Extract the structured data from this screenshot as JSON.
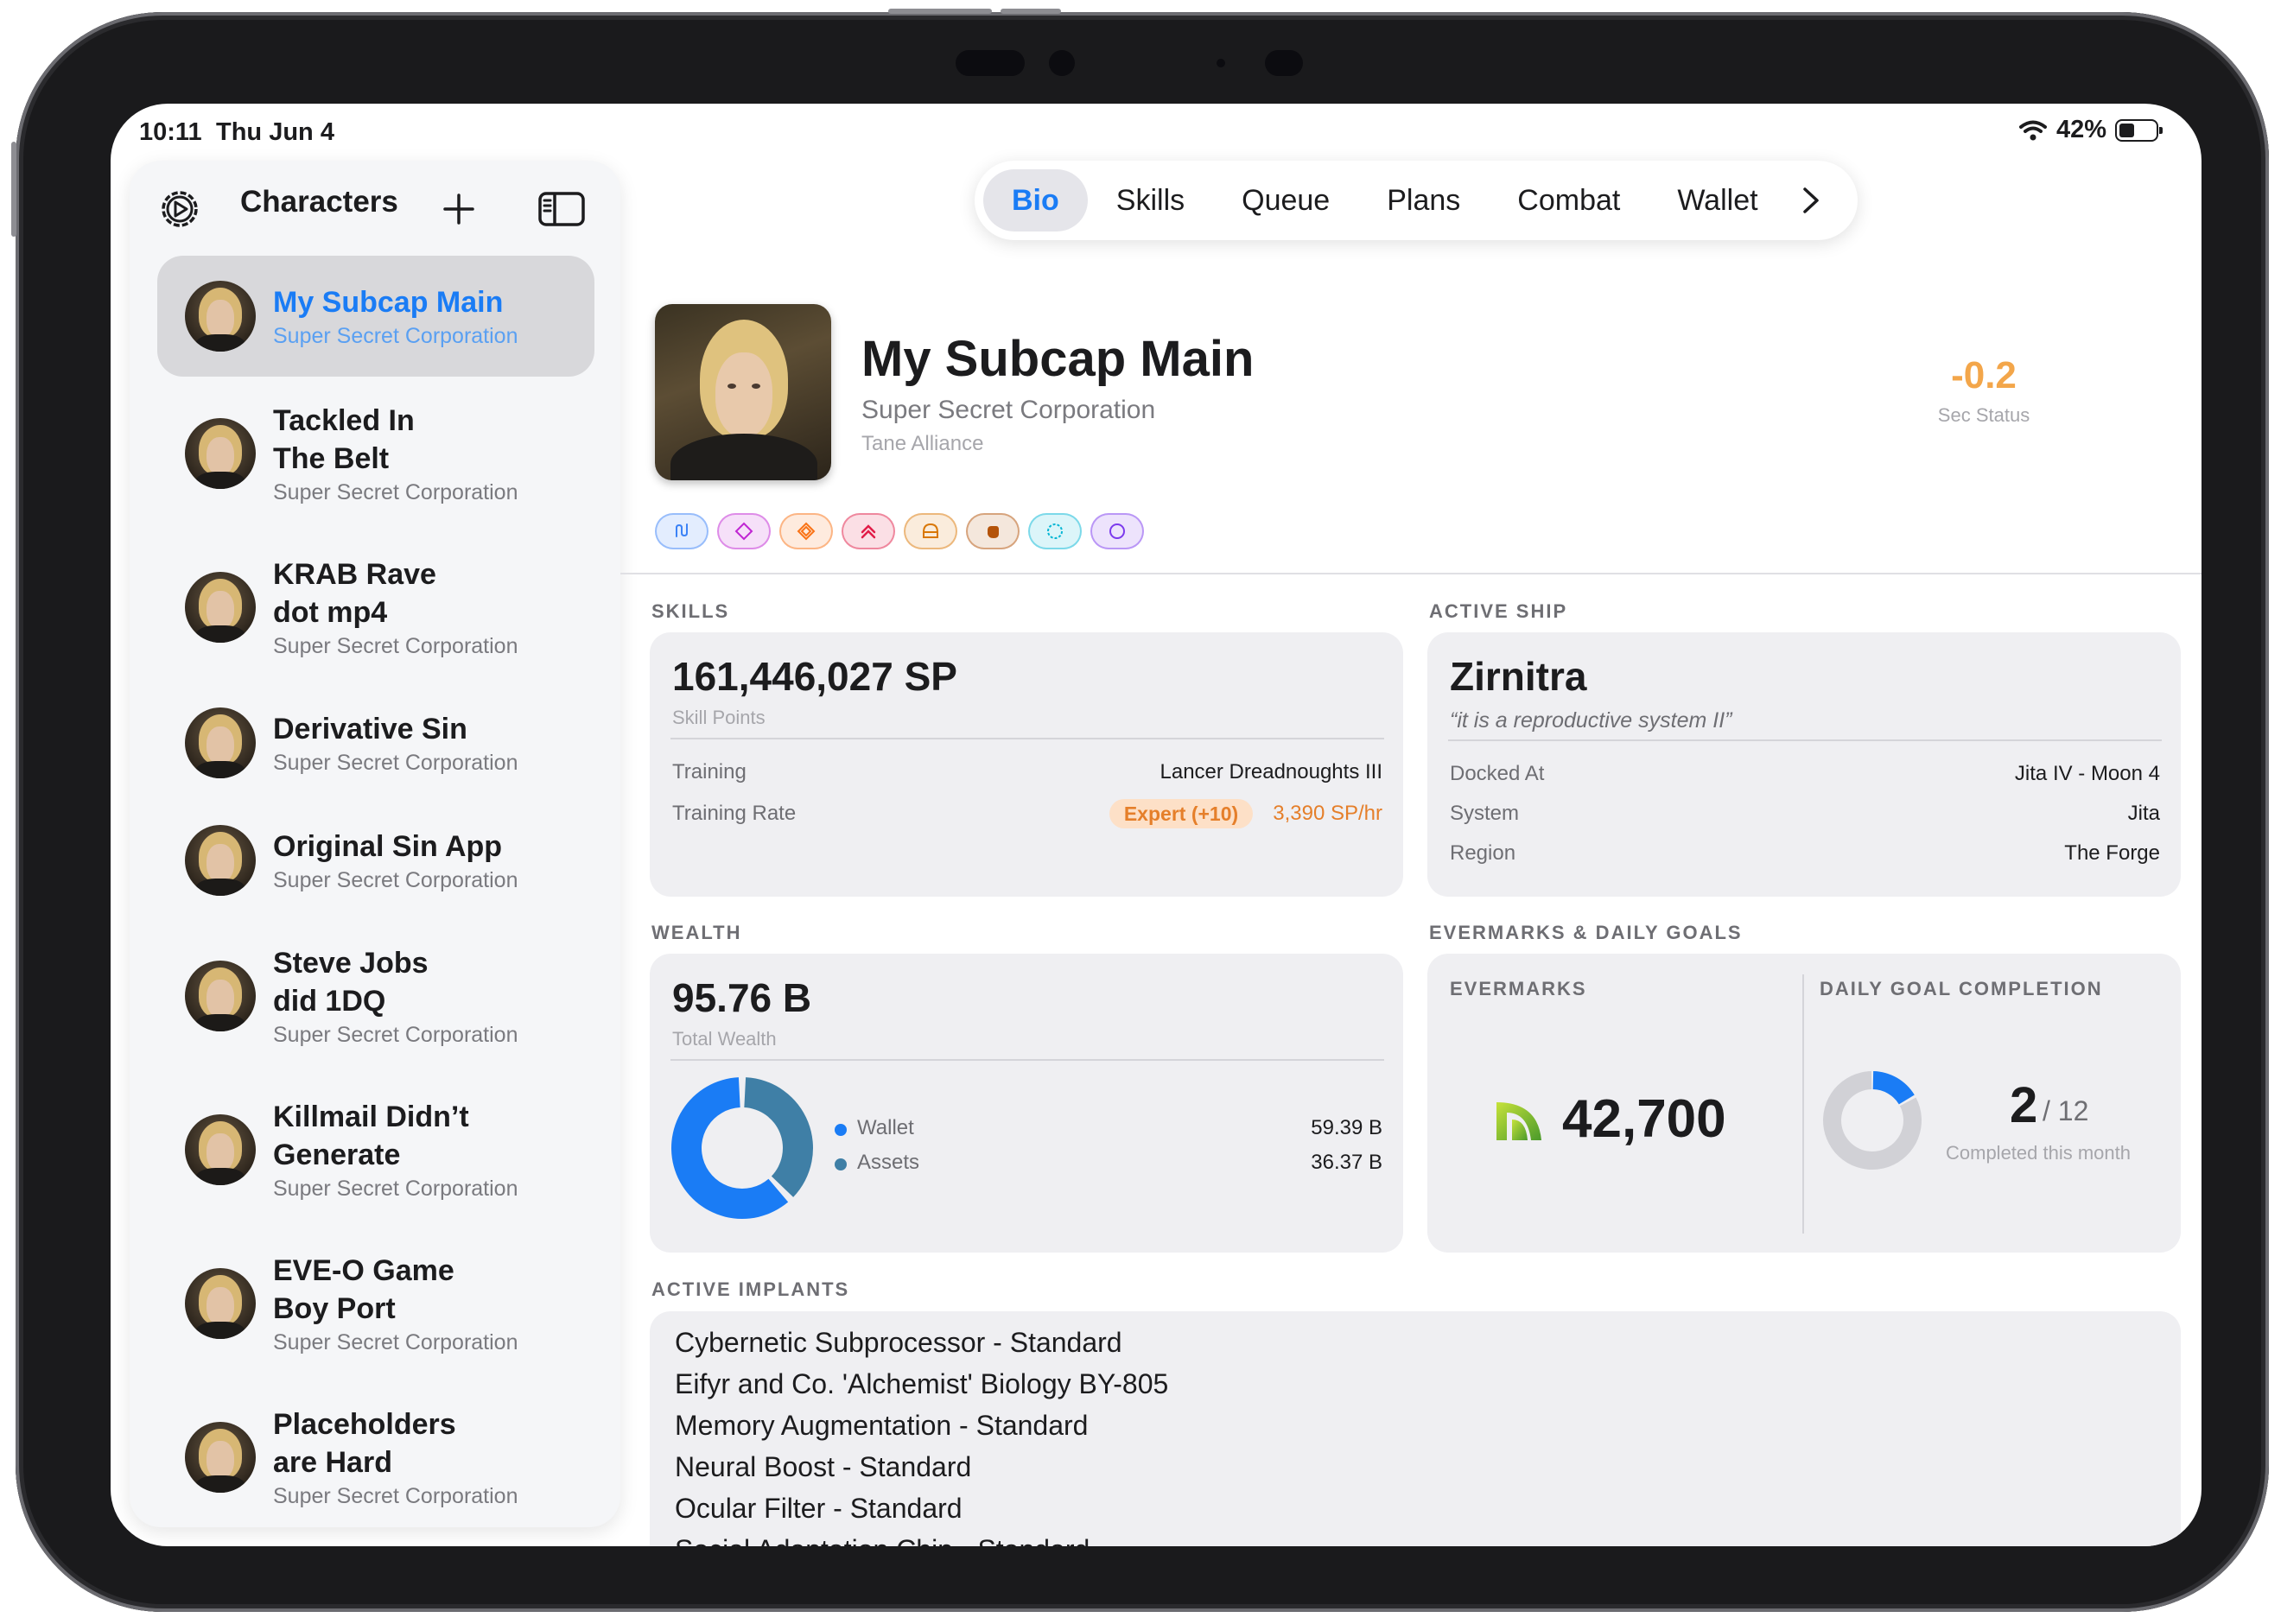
{
  "status_bar": {
    "time": "10:11",
    "date": "Thu Jun 4",
    "battery": "42%",
    "battery_level": 0.42
  },
  "sidebar": {
    "title": "Characters",
    "characters": [
      {
        "name": "My Subcap Main",
        "corporation": "Super Secret Corporation",
        "selected": true
      },
      {
        "name": "Tackled In\nThe Belt",
        "corporation": "Super Secret Corporation"
      },
      {
        "name": "KRAB Rave\ndot mp4",
        "corporation": "Super Secret Corporation"
      },
      {
        "name": "Derivative Sin",
        "corporation": "Super Secret Corporation"
      },
      {
        "name": "Original Sin App",
        "corporation": "Super Secret Corporation"
      },
      {
        "name": "Steve Jobs\ndid 1DQ",
        "corporation": "Super Secret Corporation"
      },
      {
        "name": "Killmail Didn’t\nGenerate",
        "corporation": "Super Secret Corporation"
      },
      {
        "name": "EVE-O Game\nBoy Port",
        "corporation": "Super Secret Corporation"
      },
      {
        "name": "Placeholders\nare Hard",
        "corporation": "Super Secret Corporation"
      }
    ]
  },
  "tabs": [
    "Bio",
    "Skills",
    "Queue",
    "Plans",
    "Combat",
    "Wallet"
  ],
  "active_tab": "Bio",
  "profile": {
    "name": "My Subcap Main",
    "corporation": "Super Secret Corporation",
    "alliance": "Tane Alliance",
    "sec_status": "-0.2",
    "sec_status_label": "Sec Status",
    "badges": [
      {
        "icon": "route-icon",
        "color": "#3b82f6"
      },
      {
        "icon": "diamond-icon",
        "color": "#c026d3"
      },
      {
        "icon": "diamond-orange-icon",
        "color": "#f97316"
      },
      {
        "icon": "chevrons-up-icon",
        "color": "#e11d48"
      },
      {
        "icon": "helmet-icon",
        "color": "#d97706"
      },
      {
        "icon": "fist-icon",
        "color": "#b45309"
      },
      {
        "icon": "dashed-circle-icon",
        "color": "#06b6d4"
      },
      {
        "icon": "circle-icon",
        "color": "#7c3aed"
      }
    ]
  },
  "skills": {
    "section_title": "SKILLS",
    "skill_points": "161,446,027 SP",
    "skill_points_label": "Skill Points",
    "training_label": "Training",
    "training_value": "Lancer Dreadnoughts III",
    "rate_label": "Training Rate",
    "rate_badge": "Expert (+10)",
    "rate_value": "3,390 SP/hr"
  },
  "ship": {
    "section_title": "ACTIVE SHIP",
    "name": "Zirnitra",
    "nickname": "“it is a reproductive system II”",
    "docked_label": "Docked At",
    "docked_value": "Jita IV - Moon 4",
    "system_label": "System",
    "system_value": "Jita",
    "region_label": "Region",
    "region_value": "The Forge"
  },
  "wealth": {
    "section_title": "WEALTH",
    "total": "95.76 B",
    "total_label": "Total Wealth",
    "wallet_label": "Wallet",
    "wallet_value": "59.39 B",
    "assets_label": "Assets",
    "assets_value": "36.37 B",
    "wallet_amount": 59.39,
    "assets_amount": 36.37,
    "wallet_color": "#1a7cf5",
    "assets_color": "#3f7fa6"
  },
  "evermarks": {
    "section_title": "EVERMARKS & DAILY GOALS",
    "evermarks_title": "EVERMARKS",
    "evermarks_value": "42,700",
    "daily_title": "DAILY GOAL COMPLETION",
    "completed": "2",
    "total": "/ 12",
    "completed_count": 2,
    "total_count": 12,
    "completed_label": "Completed this month"
  },
  "implants": {
    "section_title": "ACTIVE IMPLANTS",
    "items": [
      "Cybernetic Subprocessor - Standard",
      "Eifyr and Co. 'Alchemist' Biology BY-805",
      "Memory Augmentation - Standard",
      "Neural Boost - Standard",
      "Ocular Filter - Standard",
      "Social Adaptation Chip - Standard"
    ]
  }
}
